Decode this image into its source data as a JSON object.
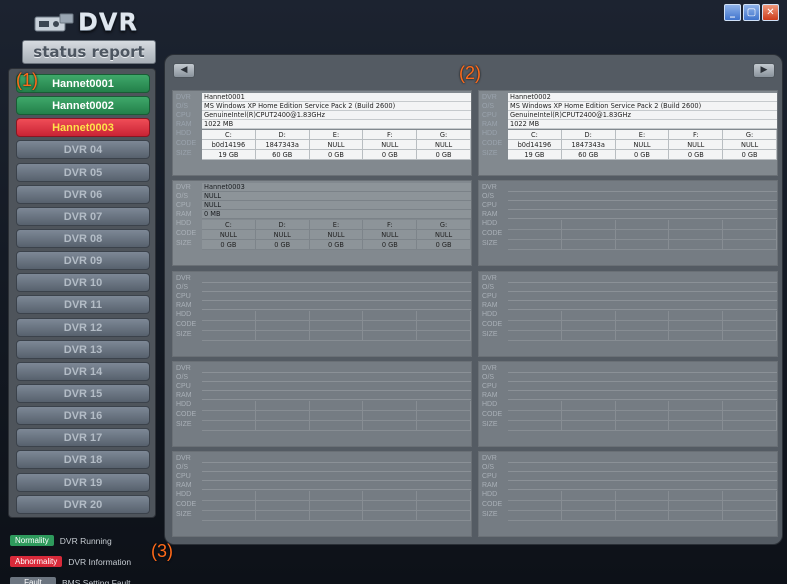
{
  "logo": {
    "title": "DVR",
    "subtitle": "status report"
  },
  "window_controls": {
    "minimize": "_",
    "maximize": "▢",
    "close": "✕"
  },
  "sidebar": {
    "items": [
      {
        "label": "Hannet0001",
        "state": "normal"
      },
      {
        "label": "Hannet0002",
        "state": "normal"
      },
      {
        "label": "Hannet0003",
        "state": "abnormal"
      },
      {
        "label": "DVR 04",
        "state": "off"
      },
      {
        "label": "DVR 05",
        "state": "off"
      },
      {
        "label": "DVR 06",
        "state": "off"
      },
      {
        "label": "DVR 07",
        "state": "off"
      },
      {
        "label": "DVR 08",
        "state": "off"
      },
      {
        "label": "DVR 09",
        "state": "off"
      },
      {
        "label": "DVR 10",
        "state": "off"
      },
      {
        "label": "DVR 11",
        "state": "off"
      },
      {
        "label": "DVR 12",
        "state": "off"
      },
      {
        "label": "DVR 13",
        "state": "off"
      },
      {
        "label": "DVR 14",
        "state": "off"
      },
      {
        "label": "DVR 15",
        "state": "off"
      },
      {
        "label": "DVR 16",
        "state": "off"
      },
      {
        "label": "DVR 17",
        "state": "off"
      },
      {
        "label": "DVR 18",
        "state": "off"
      },
      {
        "label": "DVR 19",
        "state": "off"
      },
      {
        "label": "DVR 20",
        "state": "off"
      }
    ]
  },
  "field_labels": {
    "dvr": "DVR",
    "os": "O/S",
    "cpu": "CPU",
    "ram": "RAM",
    "hdd": "HDD",
    "code": "CODE",
    "size": "SIZE"
  },
  "cards": [
    {
      "state": "active",
      "dvr": "Hannet0001",
      "os": "MS Windows XP Home Edition Service Pack 2 (Build 2600)",
      "cpu": "GenuineIntel(R)CPUT2400@1.83GHz",
      "ram": "1022 MB",
      "drives": [
        "C:",
        "D:",
        "E:",
        "F:",
        "G:"
      ],
      "codes": [
        "b0d14196",
        "1847343a",
        "NULL",
        "NULL",
        "NULL"
      ],
      "sizes": [
        "19 GB",
        "60 GB",
        "0 GB",
        "0 GB",
        "0 GB"
      ]
    },
    {
      "state": "active",
      "dvr": "Hannet0002",
      "os": "MS Windows XP Home Edition Service Pack 2 (Build 2600)",
      "cpu": "GenuineIntel(R)CPUT2400@1.83GHz",
      "ram": "1022 MB",
      "drives": [
        "C:",
        "D:",
        "E:",
        "F:",
        "G:"
      ],
      "codes": [
        "b0d14196",
        "1847343a",
        "NULL",
        "NULL",
        "NULL"
      ],
      "sizes": [
        "19 GB",
        "60 GB",
        "0 GB",
        "0 GB",
        "0 GB"
      ]
    },
    {
      "state": "partial",
      "dvr": "Hannet0003",
      "os": "NULL",
      "cpu": "NULL",
      "ram": "0 MB",
      "drives": [
        "C:",
        "D:",
        "E:",
        "F:",
        "G:"
      ],
      "codes": [
        "NULL",
        "NULL",
        "NULL",
        "NULL",
        "NULL"
      ],
      "sizes": [
        "0 GB",
        "0 GB",
        "0 GB",
        "0 GB",
        "0 GB"
      ]
    },
    {
      "state": "empty",
      "dvr": "",
      "os": "",
      "cpu": "",
      "ram": "",
      "drives": [
        "",
        "",
        "",
        "",
        ""
      ],
      "codes": [
        "",
        "",
        "",
        "",
        ""
      ],
      "sizes": [
        "",
        "",
        "",
        "",
        ""
      ]
    },
    {
      "state": "empty",
      "dvr": "",
      "os": "",
      "cpu": "",
      "ram": "",
      "drives": [
        "",
        "",
        "",
        "",
        ""
      ],
      "codes": [
        "",
        "",
        "",
        "",
        ""
      ],
      "sizes": [
        "",
        "",
        "",
        "",
        ""
      ]
    },
    {
      "state": "empty",
      "dvr": "",
      "os": "",
      "cpu": "",
      "ram": "",
      "drives": [
        "",
        "",
        "",
        "",
        ""
      ],
      "codes": [
        "",
        "",
        "",
        "",
        ""
      ],
      "sizes": [
        "",
        "",
        "",
        "",
        ""
      ]
    },
    {
      "state": "empty",
      "dvr": "",
      "os": "",
      "cpu": "",
      "ram": "",
      "drives": [
        "",
        "",
        "",
        "",
        ""
      ],
      "codes": [
        "",
        "",
        "",
        "",
        ""
      ],
      "sizes": [
        "",
        "",
        "",
        "",
        ""
      ]
    },
    {
      "state": "empty",
      "dvr": "",
      "os": "",
      "cpu": "",
      "ram": "",
      "drives": [
        "",
        "",
        "",
        "",
        ""
      ],
      "codes": [
        "",
        "",
        "",
        "",
        ""
      ],
      "sizes": [
        "",
        "",
        "",
        "",
        ""
      ]
    },
    {
      "state": "empty",
      "dvr": "",
      "os": "",
      "cpu": "",
      "ram": "",
      "drives": [
        "",
        "",
        "",
        "",
        ""
      ],
      "codes": [
        "",
        "",
        "",
        "",
        ""
      ],
      "sizes": [
        "",
        "",
        "",
        "",
        ""
      ]
    },
    {
      "state": "empty",
      "dvr": "",
      "os": "",
      "cpu": "",
      "ram": "",
      "drives": [
        "",
        "",
        "",
        "",
        ""
      ],
      "codes": [
        "",
        "",
        "",
        "",
        ""
      ],
      "sizes": [
        "",
        "",
        "",
        "",
        ""
      ]
    }
  ],
  "legend": [
    {
      "chip": "Normality",
      "text": "DVR Running",
      "kind": "n"
    },
    {
      "chip": "Abnormality",
      "text": "DVR Information",
      "kind": "a"
    },
    {
      "chip": "Fault",
      "text": "BMS Setting Fault",
      "kind": "f"
    }
  ],
  "annotations": {
    "sidebar": "(1)",
    "grid": "(2)",
    "legend": "(3)"
  },
  "colors": {
    "normal": "#2e9a5c",
    "abnormal": "#d82a3a",
    "abnormal_text": "#ffe34a",
    "annotation": "#ff6a1a"
  }
}
